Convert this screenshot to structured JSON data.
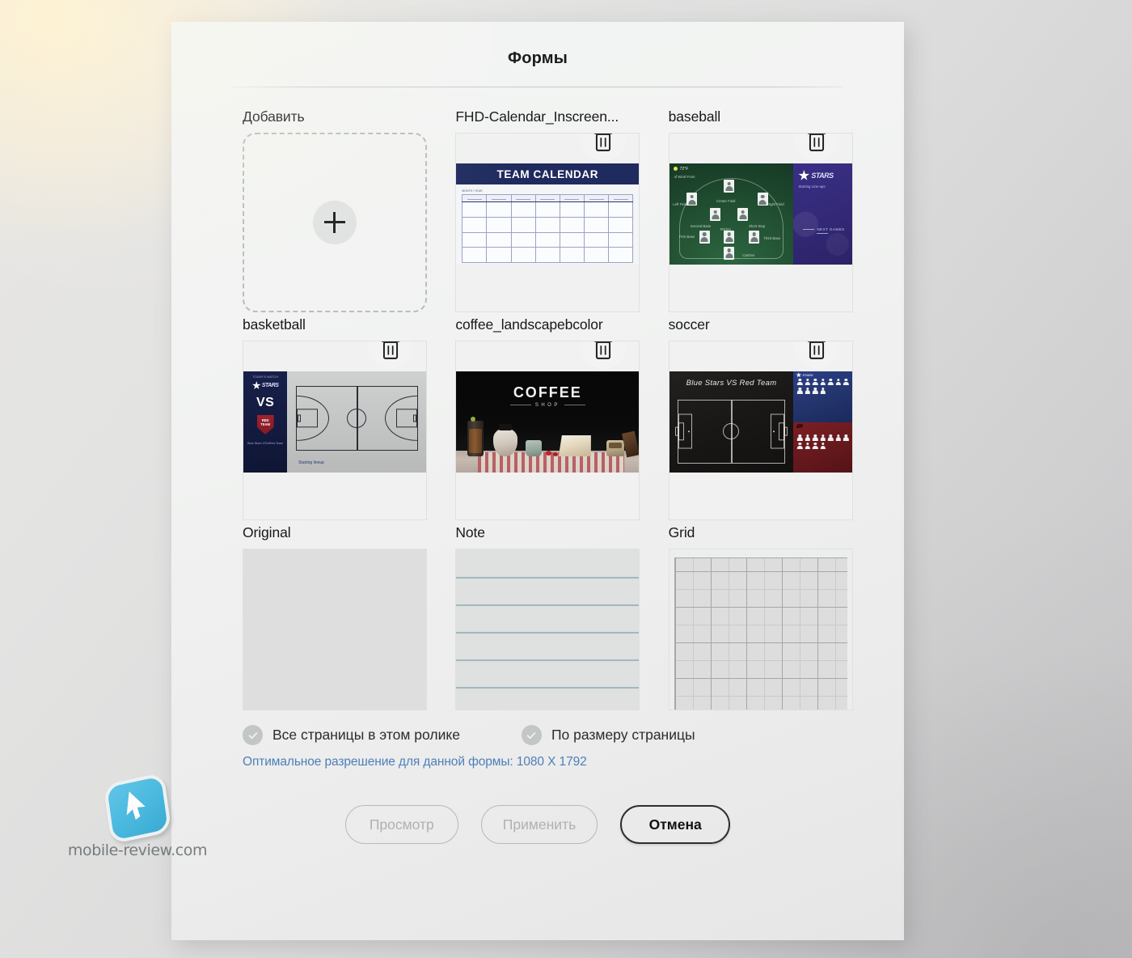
{
  "dialog": {
    "title": "Формы"
  },
  "tiles": [
    {
      "label": "Добавить",
      "kind": "add",
      "add_icon": "plus-icon",
      "deletable": false
    },
    {
      "label": "FHD-Calendar_Inscreen...",
      "kind": "calendar",
      "deletable": true,
      "delete_icon": "trash-icon",
      "artwork": {
        "header_text": "TEAM CALENDAR",
        "header_color": "#1f2a5e",
        "subtitle": "MONTH / YEAR",
        "columns": 7,
        "rows": 4
      }
    },
    {
      "label": "baseball",
      "kind": "baseball",
      "deletable": true,
      "delete_icon": "trash-icon",
      "artwork": {
        "temperature": "72°F",
        "weather_note": "of Wind From",
        "team_logo": "STARS",
        "subtitle": "Starting Line-ups",
        "next_games": "NEXT GAMES",
        "field_color": "#214f31",
        "panel_color": "#342a79",
        "positions": [
          "Center Field",
          "Left Field",
          "Right Field",
          "Second Base",
          "Short Stop",
          "First Base",
          "Pitcher",
          "Third Base",
          "Catcher"
        ]
      }
    },
    {
      "label": "basketball",
      "kind": "basketball",
      "deletable": true,
      "delete_icon": "trash-icon",
      "artwork": {
        "top_note": "TODAY'S MATCH",
        "team_logo": "STARS",
        "vs_text": "VS",
        "shield_text": "RED TEAM",
        "bottom_note": "Blue Stars VS\\nRed Team",
        "caption": "Starting lineup",
        "court_color": "#c4c5c5",
        "panel_color": "#131a3e"
      }
    },
    {
      "label": "coffee_landscapebcolor",
      "kind": "coffee",
      "deletable": true,
      "delete_icon": "trash-icon",
      "artwork": {
        "title": "COFFEE",
        "subtitle": "SHOP",
        "background_color": "#0a0a0b"
      }
    },
    {
      "label": "soccer",
      "kind": "soccer",
      "deletable": true,
      "delete_icon": "trash-icon",
      "artwork": {
        "headline": "Blue Stars VS Red Team",
        "board_color": "#1a1817",
        "blue_team_color": "#24356f",
        "red_team_color": "#68191d",
        "blue_team_logo": "STARS",
        "blue_player_count": 11,
        "red_player_count": 11
      }
    },
    {
      "label": "Original",
      "kind": "plain",
      "deletable": false,
      "artwork": {
        "background_color": "#dddedd"
      }
    },
    {
      "label": "Note",
      "kind": "note",
      "deletable": false,
      "artwork": {
        "background_color": "#dfe0e0",
        "line_color": "#9fb9bf",
        "line_count": 5
      }
    },
    {
      "label": "Grid",
      "kind": "grid",
      "deletable": false,
      "artwork": {
        "background_color": "#dcdddc",
        "minor_color": "#c9cbcb",
        "major_color": "#a5a7a8"
      }
    }
  ],
  "options": [
    {
      "label": "Все страницы в этом ролике",
      "checked": true,
      "enabled": false,
      "icon": "check-circle-icon"
    },
    {
      "label": "По размеру страницы",
      "checked": true,
      "enabled": false,
      "icon": "check-circle-icon"
    }
  ],
  "hint": {
    "text": "Оптимальное разрешение для данной формы:",
    "value": "1080 X 1792",
    "color": "#4d7fb8"
  },
  "footer": {
    "buttons": [
      {
        "label": "Просмотр",
        "state": "disabled"
      },
      {
        "label": "Применить",
        "state": "disabled"
      },
      {
        "label": "Отмена",
        "state": "primary"
      }
    ]
  },
  "watermark": {
    "text": "mobile-review.com",
    "logo_icon": "cursor-logo-icon",
    "logo_color": "#41b7e0"
  }
}
